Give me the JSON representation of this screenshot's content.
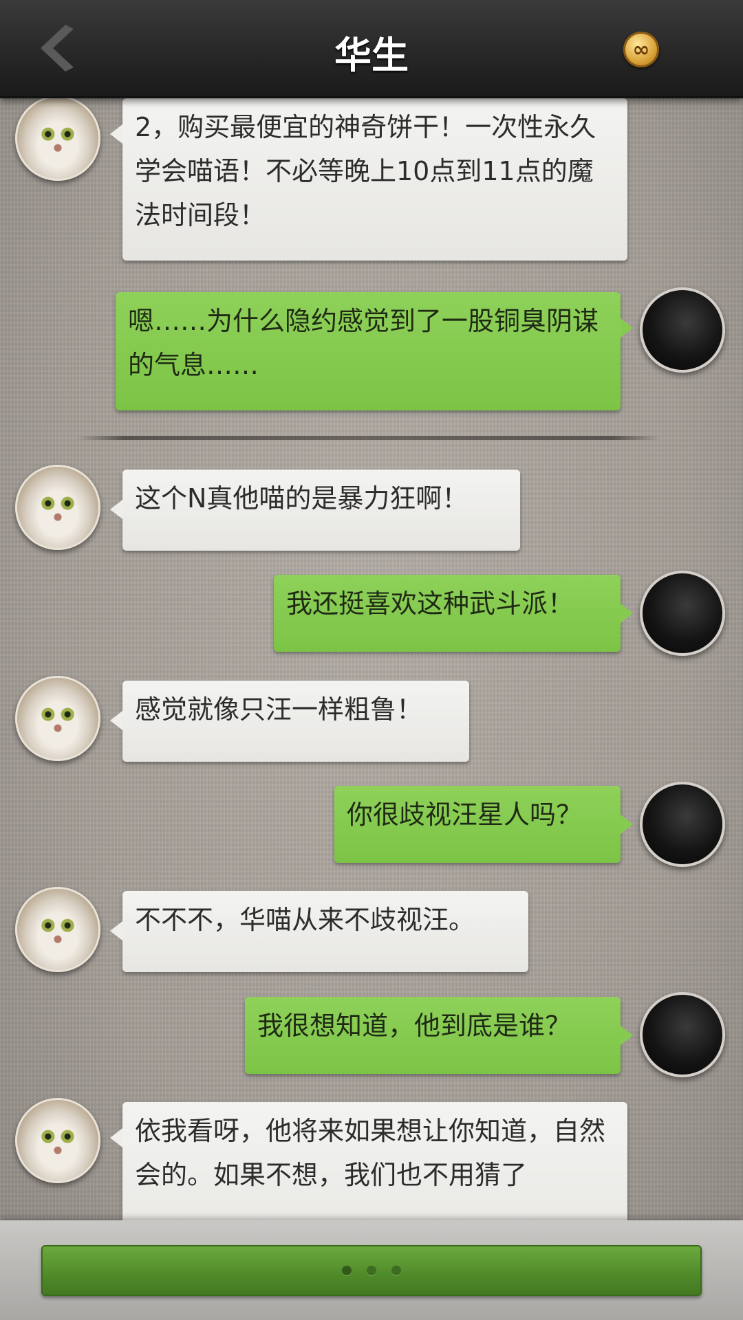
{
  "header": {
    "title": "华生",
    "back_icon": "chevron-left-icon",
    "coin_icon": "infinity-coin-icon",
    "coin_symbol": "∞"
  },
  "messages": [
    {
      "side": "in",
      "text": "2，购买最便宜的神奇饼干！一次性永久学会喵语！不必等晚上10点到11点的魔法时间段！"
    },
    {
      "side": "out",
      "text": "嗯……为什么隐约感觉到了一股铜臭阴谋的气息……"
    },
    {
      "side": "in",
      "text": "这个N真他喵的是暴力狂啊！"
    },
    {
      "side": "out",
      "text": "我还挺喜欢这种武斗派！"
    },
    {
      "side": "in",
      "text": "感觉就像只汪一样粗鲁！"
    },
    {
      "side": "out",
      "text": "你很歧视汪星人吗？"
    },
    {
      "side": "in",
      "text": "不不不，华喵从来不歧视汪。"
    },
    {
      "side": "out",
      "text": "我很想知道，他到底是谁？"
    },
    {
      "side": "in",
      "text": "依我看呀，他将来如果想让你知道，自然会的。如果不想，我们也不用猜了"
    }
  ],
  "bottom": {
    "continue_button": "continue-button",
    "dots_count": 3
  }
}
